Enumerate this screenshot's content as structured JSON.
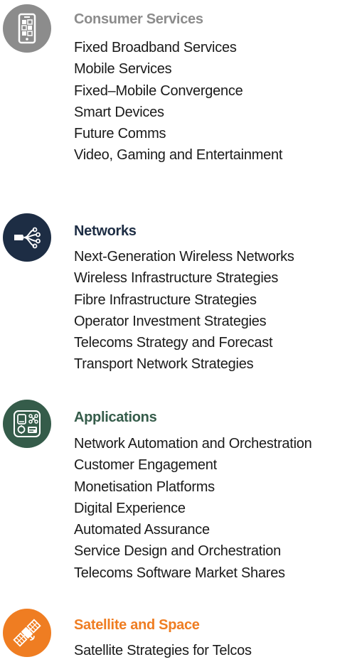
{
  "sections": [
    {
      "title": "Consumer Services",
      "title_color": "#8c8c8c",
      "icon": "smartphone-icon",
      "icon_color": "#8c8c8c",
      "items": [
        "Fixed Broadband Services",
        "Mobile Services",
        "Fixed–Mobile Convergence",
        "Smart Devices",
        "Future Comms",
        "Video, Gaming and Entertainment"
      ]
    },
    {
      "title": "Networks",
      "title_color": "#1d2d44",
      "icon": "fibre-network-icon",
      "icon_color": "#1d2d44",
      "items": [
        "Next-Generation Wireless Networks",
        "Wireless Infrastructure Strategies",
        "Fibre Infrastructure Strategies",
        "Operator Investment Strategies",
        "Telecoms Strategy and Forecast",
        "Transport Network Strategies"
      ]
    },
    {
      "title": "Applications",
      "title_color": "#355c4a",
      "icon": "apps-devices-icon",
      "icon_color": "#355c4a",
      "items": [
        "Network Automation and Orchestration",
        "Customer Engagement",
        "Monetisation Platforms",
        "Digital Experience",
        "Automated Assurance",
        "Service Design and Orchestration",
        "Telecoms Software Market Shares"
      ]
    },
    {
      "title": "Satellite and Space",
      "title_color": "#ef7d22",
      "icon": "satellite-icon",
      "icon_color": "#ef7d22",
      "items": [
        "Satellite Strategies for Telcos"
      ]
    }
  ]
}
